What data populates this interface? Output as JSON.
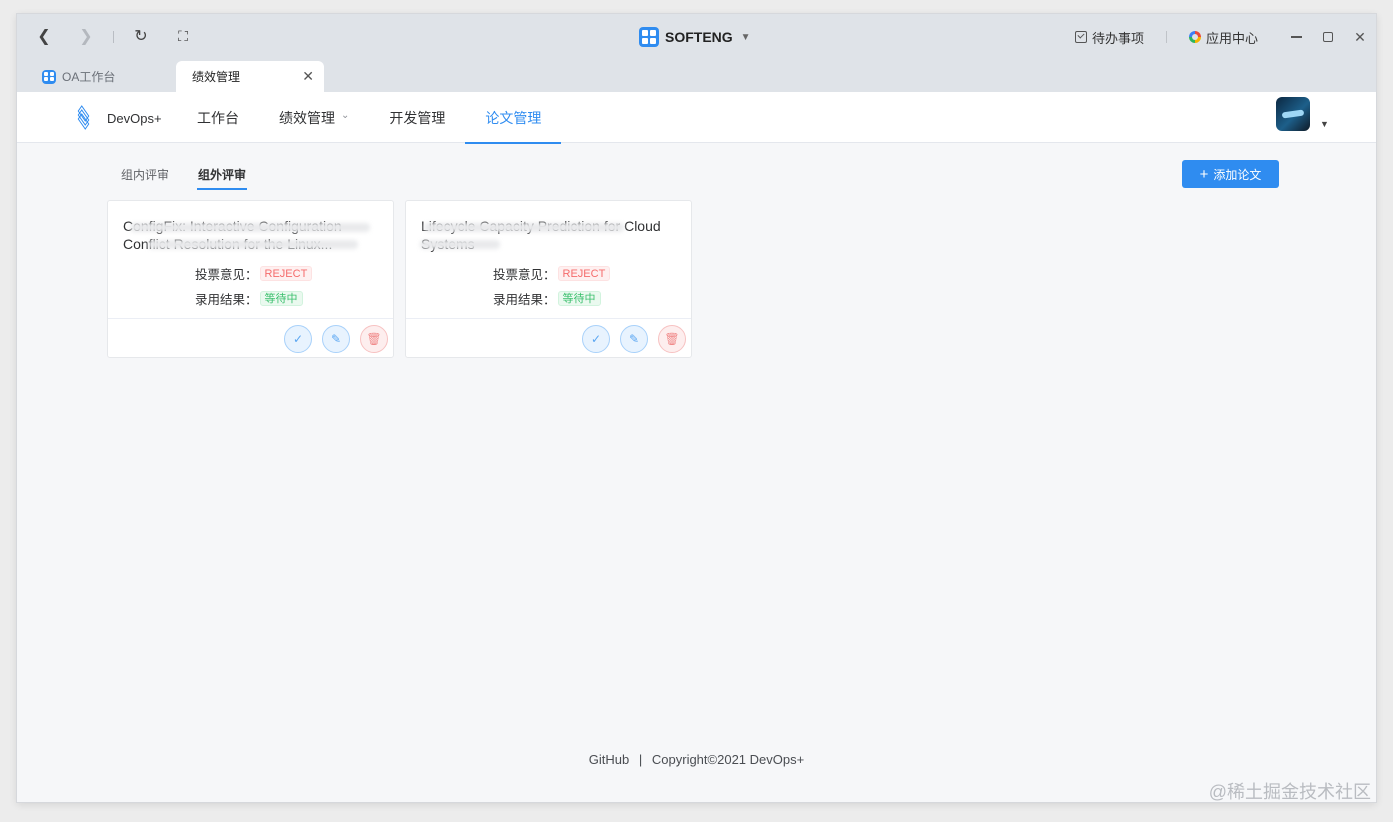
{
  "titlebar": {
    "brand": "SOFTENG",
    "todo_label": "待办事项",
    "app_center_label": "应用中心"
  },
  "browser_tabs": [
    {
      "label": "OA工作台"
    },
    {
      "label": "绩效管理"
    }
  ],
  "appnav": {
    "app_name": "DevOps+",
    "menu": [
      {
        "label": "工作台"
      },
      {
        "label": "绩效管理"
      },
      {
        "label": "开发管理"
      },
      {
        "label": "论文管理"
      }
    ]
  },
  "subtabs": [
    {
      "label": "组内评审"
    },
    {
      "label": "组外评审"
    }
  ],
  "add_button_label": "添加论文",
  "cards": [
    {
      "title": "ConfigFix: Interactive Configuration Conflict Resolution for the Linux...",
      "vote_label": "投票意见：",
      "vote_value": "REJECT",
      "result_label": "录用结果：",
      "result_value": "等待中"
    },
    {
      "title": "Lifecycle Capacity Prediction for Cloud Systems",
      "vote_label": "投票意见：",
      "vote_value": "REJECT",
      "result_label": "录用结果：",
      "result_value": "等待中"
    }
  ],
  "footer": {
    "github": "GitHub",
    "separator": "|",
    "copyright": "Copyright©2021 DevOps+"
  },
  "watermark": "@稀土掘金技术社区",
  "colors": {
    "accent": "#2f8cf0",
    "reject": "#f56c6c",
    "pending": "#3cc06e"
  }
}
